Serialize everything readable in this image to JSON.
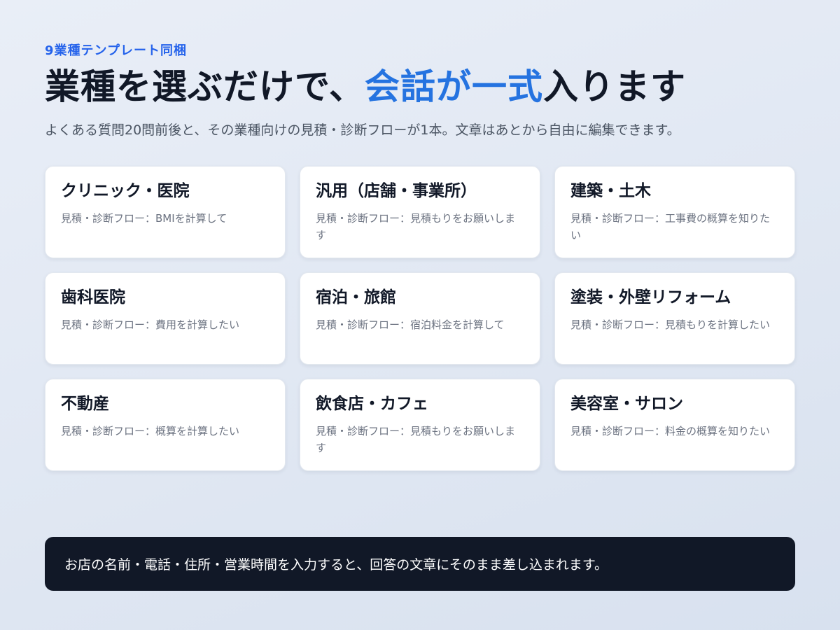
{
  "eyebrow": "9業種テンプレート同梱",
  "headline": {
    "part1": "業種を選ぶだけで、",
    "accent": "会話が一式",
    "part2": "入ります"
  },
  "subtitle": "よくある質問20問前後と、その業種向けの見積・診断フローが1本。文章はあとから自由に編集できます。",
  "cards": [
    {
      "title": "クリニック・医院",
      "desc": "見積・診断フロー：BMIを計算して"
    },
    {
      "title": "汎用（店舗・事業所）",
      "desc": "見積・診断フロー：見積もりをお願いします"
    },
    {
      "title": "建築・土木",
      "desc": "見積・診断フロー：工事費の概算を知りたい"
    },
    {
      "title": "歯科医院",
      "desc": "見積・診断フロー：費用を計算したい"
    },
    {
      "title": "宿泊・旅館",
      "desc": "見積・診断フロー：宿泊料金を計算して"
    },
    {
      "title": "塗装・外壁リフォーム",
      "desc": "見積・診断フロー：見積もりを計算したい"
    },
    {
      "title": "不動産",
      "desc": "見積・診断フロー：概算を計算したい"
    },
    {
      "title": "飲食店・カフェ",
      "desc": "見積・診断フロー：見積もりをお願いします"
    },
    {
      "title": "美容室・サロン",
      "desc": "見積・診断フロー：料金の概算を知りたい"
    }
  ],
  "banner": "お店の名前・電話・住所・営業時間を入力すると、回答の文章にそのまま差し込まれます。",
  "colors": {
    "accent": "#2573e0",
    "eyebrow": "#2563eb",
    "banner_bg": "#111827"
  }
}
